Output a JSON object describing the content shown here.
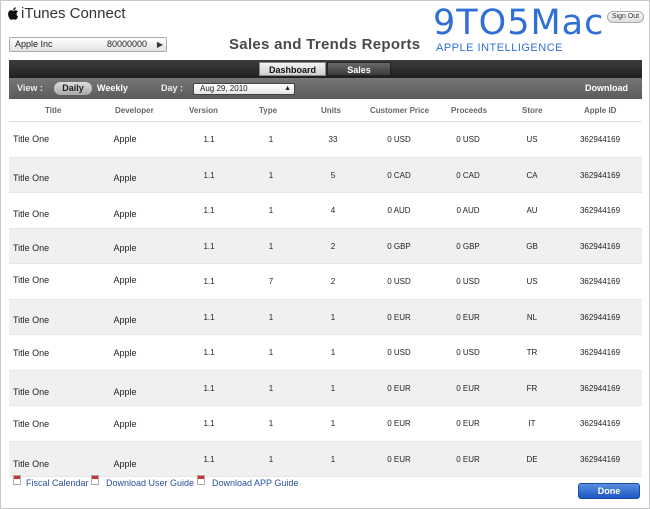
{
  "app": {
    "title": "iTunes Connect",
    "sign_out_label": "Sign Out"
  },
  "watermark": {
    "logo_text": "9TO5Mac",
    "tagline": "APPLE INTELLIGENCE"
  },
  "account": {
    "name": "Apple Inc",
    "number": "80000000"
  },
  "page_title": "Sales and Trends Reports",
  "tabs": [
    {
      "label": "Dashboard",
      "active": true
    },
    {
      "label": "Sales",
      "active": false
    }
  ],
  "controls": {
    "view_label": "View :",
    "view_options": [
      "Daily",
      "Weekly"
    ],
    "view_selected": "Daily",
    "day_label": "Day :",
    "day_value": "Aug 29, 2010",
    "download_label": "Download"
  },
  "table": {
    "columns": [
      "Title",
      "Developer",
      "Version",
      "Type",
      "Units",
      "Customer Price",
      "Proceeds",
      "Store",
      "Apple ID"
    ],
    "rows": [
      [
        "Title One",
        "Apple",
        "1.1",
        "1",
        "33",
        "0 USD",
        "0 USD",
        "US",
        "362944169"
      ],
      [
        "Title One",
        "Apple",
        "1.1",
        "1",
        "5",
        "0 CAD",
        "0 CAD",
        "CA",
        "362944169"
      ],
      [
        "Title One",
        "Apple",
        "1.1",
        "1",
        "4",
        "0 AUD",
        "0 AUD",
        "AU",
        "362944169"
      ],
      [
        "Title One",
        "Apple",
        "1.1",
        "1",
        "2",
        "0 GBP",
        "0 GBP",
        "GB",
        "362944169"
      ],
      [
        "Title One",
        "Apple",
        "1.1",
        "7",
        "2",
        "0 USD",
        "0 USD",
        "US",
        "362944169"
      ],
      [
        "Title One",
        "Apple",
        "1.1",
        "1",
        "1",
        "0 EUR",
        "0 EUR",
        "NL",
        "362944169"
      ],
      [
        "Title One",
        "Apple",
        "1.1",
        "1",
        "1",
        "0 USD",
        "0 USD",
        "TR",
        "362944169"
      ],
      [
        "Title One",
        "Apple",
        "1.1",
        "1",
        "1",
        "0 EUR",
        "0 EUR",
        "FR",
        "362944169"
      ],
      [
        "Title One",
        "Apple",
        "1.1",
        "1",
        "1",
        "0 EUR",
        "0 EUR",
        "IT",
        "362944169"
      ],
      [
        "Title One",
        "Apple",
        "1.1",
        "1",
        "1",
        "0 EUR",
        "0 EUR",
        "DE",
        "362944169"
      ]
    ]
  },
  "footer": {
    "links": [
      "Fiscal Calendar",
      "Download User Guide",
      "Download APP Guide"
    ],
    "done_label": "Done"
  },
  "colors": {
    "accent": "#2f6fd6",
    "link": "#2a4f9c",
    "done_button": "#1c57c2"
  }
}
